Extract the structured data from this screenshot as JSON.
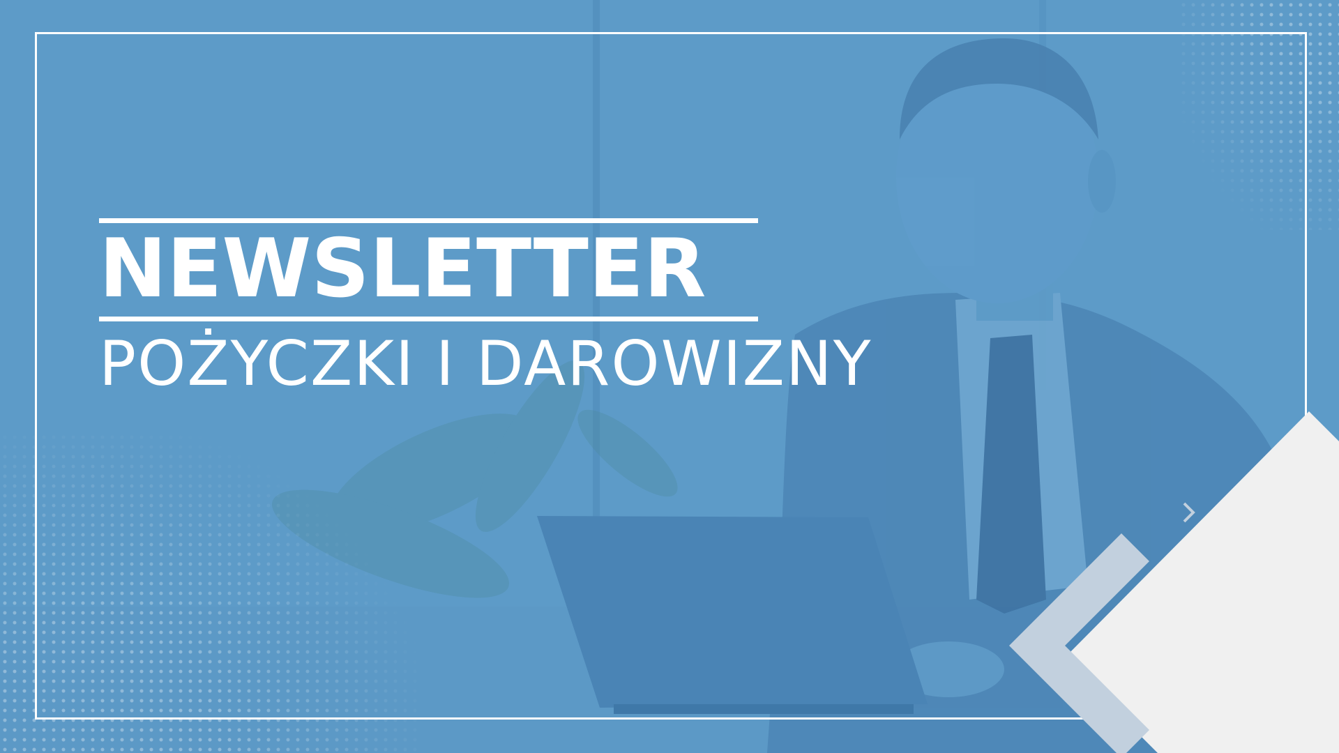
{
  "banner": {
    "headline": "NEWSLETTER",
    "subline": "POŻYCZKI I DAROWIZNY"
  },
  "colors": {
    "background": "#5d9bc8",
    "text": "#ffffff",
    "accent_light": "#f0f0f0",
    "accent_muted": "#c2d0de"
  },
  "decorations": {
    "background_image": "businessman-with-laptop-photo",
    "corner_shape": "chevron-arrow-icon"
  }
}
